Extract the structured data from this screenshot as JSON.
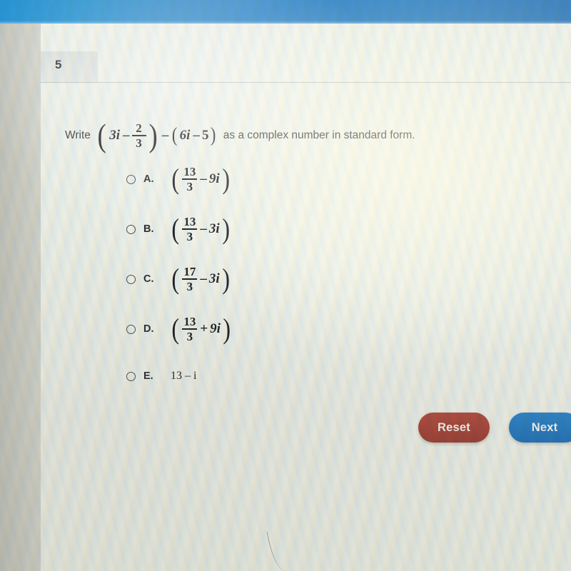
{
  "topbar": {
    "label": "browser-top-bar"
  },
  "question": {
    "number": "5",
    "prefix": "Write",
    "expr": {
      "open_paren": "(",
      "term1": "3i",
      "minus1": "–",
      "fraction": {
        "numerator": "2",
        "denominator": "3"
      },
      "close_paren": ")",
      "minus2": "–",
      "group2_open": "(",
      "group2_term1": "6i",
      "group2_minus": "–",
      "group2_term2": "5",
      "group2_close": ")"
    },
    "suffix": "as a complex number in standard form."
  },
  "options": [
    {
      "letter": "A.",
      "selected": false,
      "form": "fraction",
      "open_paren": "(",
      "numerator": "13",
      "denominator": "3",
      "operator": "–",
      "imaginary": "9i",
      "close_paren": ")"
    },
    {
      "letter": "B.",
      "selected": false,
      "form": "fraction",
      "open_paren": "(",
      "numerator": "13",
      "denominator": "3",
      "operator": "–",
      "imaginary": "3i",
      "close_paren": ")"
    },
    {
      "letter": "C.",
      "selected": false,
      "form": "fraction",
      "open_paren": "(",
      "numerator": "17",
      "denominator": "3",
      "operator": "–",
      "imaginary": "3i",
      "close_paren": ")"
    },
    {
      "letter": "D.",
      "selected": false,
      "form": "fraction",
      "open_paren": "(",
      "numerator": "13",
      "denominator": "3",
      "operator": "+",
      "imaginary": "9i",
      "close_paren": ")"
    },
    {
      "letter": "E.",
      "selected": false,
      "form": "plain",
      "text": "13 – i"
    }
  ],
  "footer": {
    "reset_label": "Reset",
    "next_label": "Next"
  },
  "colors": {
    "topbar_blue": "#1f8fd2",
    "reset_red": "#a4443a",
    "next_blue": "#2878bd",
    "card_bg": "#eceee9",
    "text": "#2f3136"
  }
}
